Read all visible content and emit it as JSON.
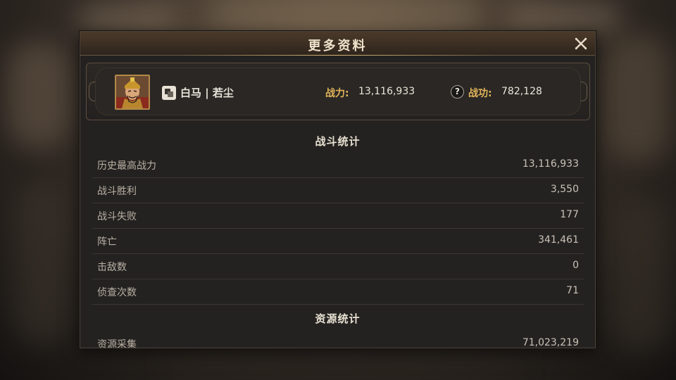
{
  "dialog": {
    "title": "更多资料"
  },
  "profile": {
    "server_and_name": "白马 | 若尘",
    "power_label": "战力:",
    "power_value": "13,116,933",
    "merit_label": "战功:",
    "merit_value": "782,128",
    "help_icon_glyph": "?"
  },
  "battle_stats": {
    "header": "战斗统计",
    "rows": [
      {
        "label": "历史最高战力",
        "value": "13,116,933"
      },
      {
        "label": "战斗胜利",
        "value": "3,550"
      },
      {
        "label": "战斗失败",
        "value": "177"
      },
      {
        "label": "阵亡",
        "value": "341,461"
      },
      {
        "label": "击敌数",
        "value": "0"
      },
      {
        "label": "侦查次数",
        "value": "71"
      }
    ]
  },
  "resource_stats": {
    "header": "资源统计",
    "rows": [
      {
        "label": "资源采集",
        "value": "71,023,219"
      }
    ]
  },
  "colors": {
    "accent_gold": "#e2b45a",
    "panel_bg": "#242221",
    "title_text": "#efe3cc"
  },
  "icons": {
    "close": "close-icon",
    "help": "help-icon",
    "server": "server-icon",
    "avatar": "general-portrait"
  }
}
